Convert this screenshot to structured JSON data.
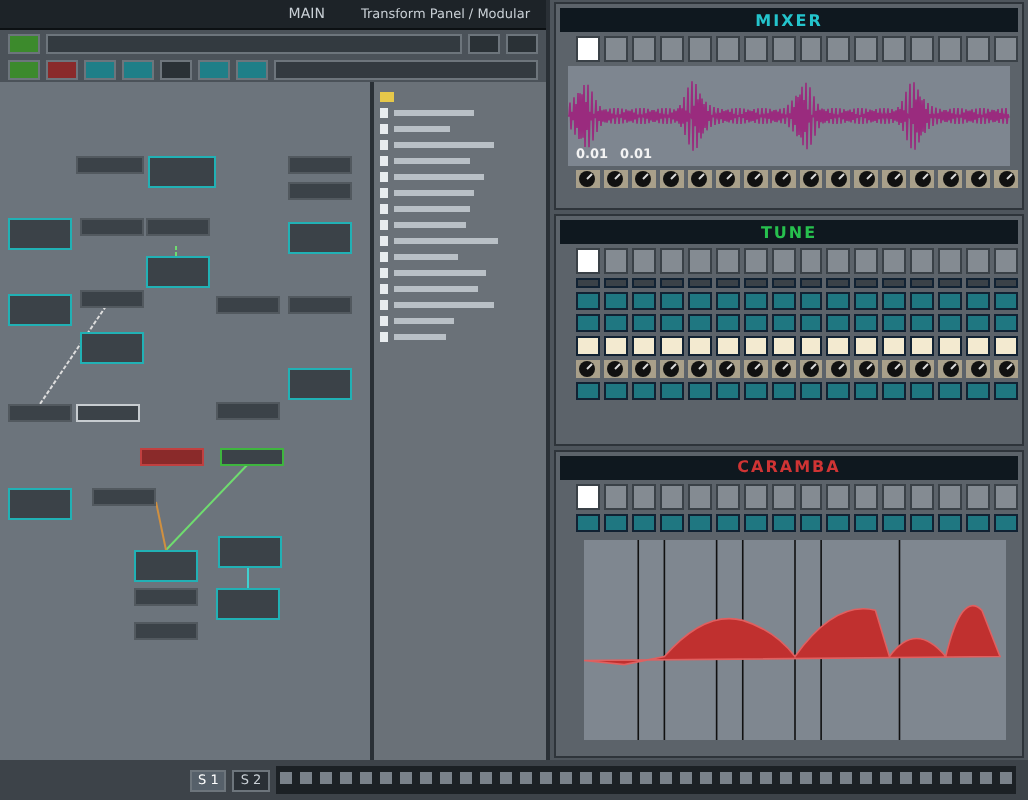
{
  "main_window": {
    "title": "MAIN",
    "subtitle": "Transform Panel / Modular"
  },
  "modules": [
    {
      "kind": "mixer",
      "title": "MIXER",
      "pads": [
        {
          "selected": true
        },
        {
          "selected": false
        },
        {
          "selected": false
        },
        {
          "selected": false
        },
        {
          "selected": false
        },
        {
          "selected": false
        },
        {
          "selected": false
        },
        {
          "selected": false
        },
        {
          "selected": false
        },
        {
          "selected": false
        },
        {
          "selected": false
        },
        {
          "selected": false
        },
        {
          "selected": false
        },
        {
          "selected": false
        },
        {
          "selected": false
        },
        {
          "selected": false
        }
      ],
      "markers": [
        "0.01",
        "0.01"
      ]
    },
    {
      "kind": "sequencer",
      "title": "TUNE",
      "pads": [
        {
          "selected": true
        },
        {
          "selected": false
        },
        {
          "selected": false
        },
        {
          "selected": false
        },
        {
          "selected": false
        },
        {
          "selected": false
        },
        {
          "selected": false
        },
        {
          "selected": false
        },
        {
          "selected": false
        },
        {
          "selected": false
        },
        {
          "selected": false
        },
        {
          "selected": false
        },
        {
          "selected": false
        },
        {
          "selected": false
        },
        {
          "selected": false
        },
        {
          "selected": false
        }
      ]
    },
    {
      "kind": "envelope",
      "title": "CARAMBA",
      "pads": [
        {
          "selected": true
        },
        {
          "selected": false
        },
        {
          "selected": false
        },
        {
          "selected": false
        },
        {
          "selected": false
        },
        {
          "selected": false
        },
        {
          "selected": false
        },
        {
          "selected": false
        },
        {
          "selected": false
        },
        {
          "selected": false
        },
        {
          "selected": false
        },
        {
          "selected": false
        },
        {
          "selected": false
        },
        {
          "selected": false
        },
        {
          "selected": false
        },
        {
          "selected": false
        }
      ]
    }
  ],
  "song": {
    "tabs": [
      {
        "label": "S 1",
        "selected": true
      },
      {
        "label": "S 2",
        "selected": false
      }
    ]
  }
}
